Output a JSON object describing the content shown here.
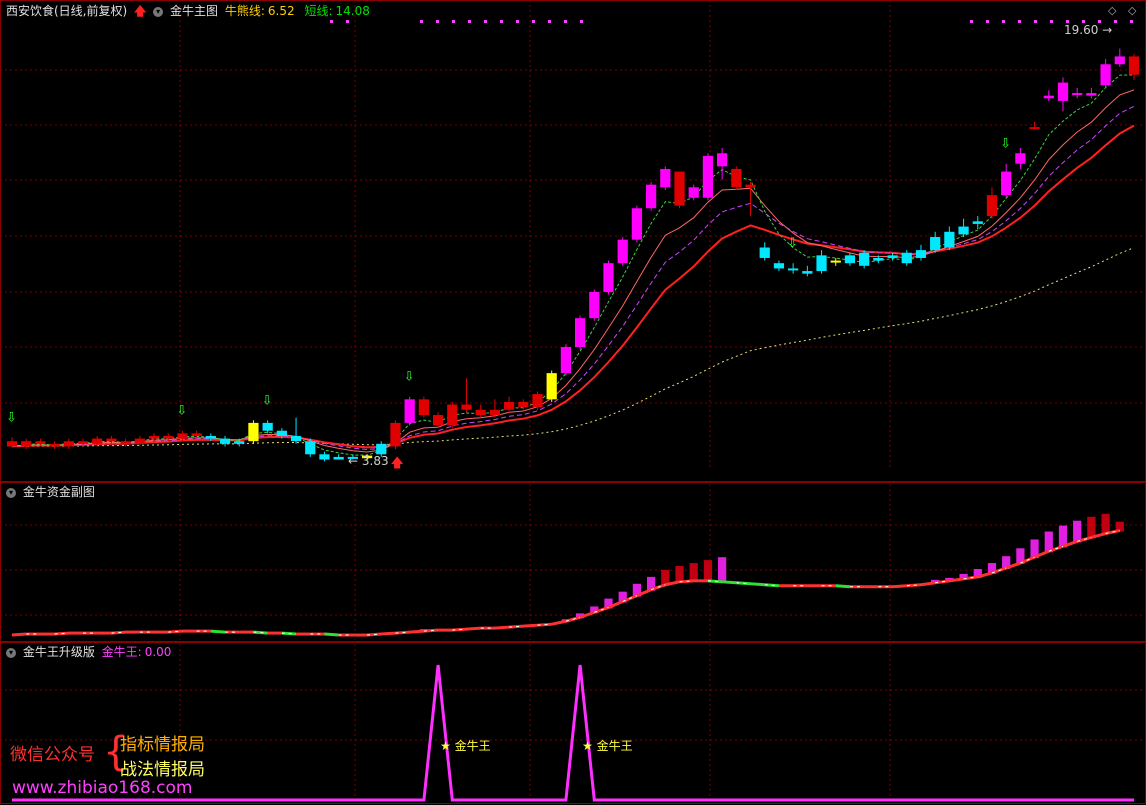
{
  "header": {
    "stock_title": "西安饮食(日线,前复权)",
    "main_indicator": "金牛主图",
    "bull_label": "牛熊线:",
    "bull_value": "6.52",
    "short_label": "短线:",
    "short_value": "14.08",
    "sub1_title": "金牛资金副图",
    "sub2_title": "金牛王升级版",
    "king_label": "金牛王:",
    "king_value": "0.00"
  },
  "colors": {
    "up": "#ff00ff",
    "up_big": "#e00000",
    "down": "#00e8ff",
    "signal": "#ffff00",
    "grid": "#7a0000",
    "bull_line": "#ff2020",
    "short_line": "#ff6666",
    "mid_line": "#cc44ff",
    "fast_line": "#40d040",
    "long_line": "#e8e070"
  },
  "chart_data": {
    "type": "candlestick",
    "price_high_label": "19.60",
    "price_low_label": "3.83",
    "candles": [
      [
        4.6,
        4.4,
        4.75,
        4.35,
        "r"
      ],
      [
        4.4,
        4.6,
        4.7,
        4.3,
        "r"
      ],
      [
        4.6,
        4.5,
        4.7,
        4.4,
        "r"
      ],
      [
        4.5,
        4.4,
        4.6,
        4.3,
        "r"
      ],
      [
        4.4,
        4.6,
        4.7,
        4.3,
        "r"
      ],
      [
        4.6,
        4.5,
        4.7,
        4.4,
        "r"
      ],
      [
        4.5,
        4.7,
        4.8,
        4.4,
        "r"
      ],
      [
        4.7,
        4.6,
        4.8,
        4.5,
        "r"
      ],
      [
        4.6,
        4.5,
        4.7,
        4.4,
        "r"
      ],
      [
        4.5,
        4.7,
        4.8,
        4.4,
        "r"
      ],
      [
        4.7,
        4.8,
        4.9,
        4.6,
        "r"
      ],
      [
        4.8,
        4.7,
        4.9,
        4.6,
        "r"
      ],
      [
        4.7,
        4.9,
        5.0,
        4.6,
        "r"
      ],
      [
        4.9,
        4.8,
        5.0,
        4.7,
        "r"
      ],
      [
        4.8,
        4.7,
        4.9,
        4.6,
        "c"
      ],
      [
        4.7,
        4.5,
        4.8,
        4.4,
        "c"
      ],
      [
        4.5,
        4.6,
        4.7,
        4.4,
        "c"
      ],
      [
        4.6,
        5.3,
        5.4,
        4.5,
        "y"
      ],
      [
        5.3,
        5.0,
        5.4,
        4.9,
        "c"
      ],
      [
        5.0,
        4.8,
        5.1,
        4.7,
        "c"
      ],
      [
        4.8,
        4.6,
        5.5,
        4.5,
        "c"
      ],
      [
        4.6,
        4.1,
        4.7,
        4.0,
        "c"
      ],
      [
        4.1,
        3.9,
        4.2,
        3.83,
        "c"
      ],
      [
        3.9,
        4.0,
        4.1,
        3.9,
        "c"
      ],
      [
        4.0,
        3.95,
        4.1,
        3.9,
        "c"
      ],
      [
        3.95,
        4.05,
        4.1,
        3.9,
        "y"
      ],
      [
        4.1,
        4.5,
        4.6,
        4.0,
        "c"
      ],
      [
        4.4,
        5.3,
        5.4,
        4.3,
        "r"
      ],
      [
        5.3,
        6.2,
        6.3,
        5.2,
        "m"
      ],
      [
        6.2,
        5.6,
        6.3,
        5.5,
        "r"
      ],
      [
        5.6,
        5.2,
        5.7,
        5.1,
        "r"
      ],
      [
        5.2,
        6.0,
        6.1,
        5.1,
        "r"
      ],
      [
        6.0,
        5.8,
        7.0,
        5.7,
        "r"
      ],
      [
        5.8,
        5.6,
        6.0,
        5.5,
        "r"
      ],
      [
        5.6,
        5.8,
        6.2,
        5.5,
        "r"
      ],
      [
        5.8,
        6.1,
        6.3,
        5.7,
        "r"
      ],
      [
        6.1,
        5.9,
        6.2,
        5.8,
        "r"
      ],
      [
        5.9,
        6.4,
        6.5,
        5.8,
        "r"
      ],
      [
        6.2,
        7.2,
        7.3,
        6.1,
        "y"
      ],
      [
        7.2,
        8.2,
        8.3,
        7.1,
        "m"
      ],
      [
        8.2,
        9.3,
        9.4,
        8.1,
        "m"
      ],
      [
        9.3,
        10.3,
        10.4,
        9.2,
        "m"
      ],
      [
        10.3,
        11.4,
        11.5,
        10.2,
        "m"
      ],
      [
        11.4,
        12.3,
        12.4,
        11.3,
        "m"
      ],
      [
        12.3,
        13.5,
        13.6,
        12.2,
        "m"
      ],
      [
        13.5,
        14.4,
        14.5,
        13.4,
        "m"
      ],
      [
        14.3,
        15.0,
        15.1,
        14.2,
        "m"
      ],
      [
        14.9,
        13.6,
        14.9,
        13.5,
        "r"
      ],
      [
        13.9,
        14.3,
        14.4,
        13.8,
        "m"
      ],
      [
        13.9,
        15.5,
        15.6,
        13.8,
        "m"
      ],
      [
        15.1,
        15.6,
        15.8,
        14.6,
        "m"
      ],
      [
        15.0,
        14.3,
        15.1,
        14.2,
        "r"
      ],
      [
        14.3,
        14.4,
        14.5,
        13.2,
        "r"
      ],
      [
        12.0,
        11.6,
        12.2,
        11.5,
        "c"
      ],
      [
        11.4,
        11.2,
        11.5,
        11.1,
        "c"
      ],
      [
        11.2,
        11.2,
        11.4,
        11.0,
        "c"
      ],
      [
        11.0,
        11.1,
        11.3,
        10.9,
        "c"
      ],
      [
        11.1,
        11.7,
        11.9,
        11.0,
        "c"
      ],
      [
        11.5,
        11.5,
        11.6,
        11.3,
        "y"
      ],
      [
        11.7,
        11.4,
        11.8,
        11.3,
        "c"
      ],
      [
        11.8,
        11.3,
        11.9,
        11.2,
        "c"
      ],
      [
        11.5,
        11.6,
        11.7,
        11.4,
        "c"
      ],
      [
        11.6,
        11.7,
        11.8,
        11.5,
        "c"
      ],
      [
        11.8,
        11.4,
        11.9,
        11.3,
        "c"
      ],
      [
        11.6,
        11.9,
        12.1,
        11.5,
        "c"
      ],
      [
        11.9,
        12.4,
        12.6,
        11.8,
        "c"
      ],
      [
        12.0,
        12.6,
        12.8,
        11.9,
        "c"
      ],
      [
        12.5,
        12.8,
        13.1,
        12.4,
        "c"
      ],
      [
        12.9,
        13.0,
        13.2,
        12.7,
        "c"
      ],
      [
        13.2,
        14.0,
        14.3,
        13.1,
        "r"
      ],
      [
        14.0,
        14.9,
        15.2,
        13.9,
        "m"
      ],
      [
        15.2,
        15.6,
        15.8,
        15.0,
        "m"
      ],
      [
        16.6,
        16.6,
        16.8,
        16.5,
        "r"
      ],
      [
        17.8,
        17.7,
        18.0,
        17.6,
        "m"
      ],
      [
        18.3,
        17.6,
        18.5,
        17.2,
        "m"
      ],
      [
        17.9,
        17.9,
        18.1,
        17.7,
        "m"
      ],
      [
        17.8,
        17.9,
        18.1,
        17.7,
        "m"
      ],
      [
        18.2,
        19.0,
        19.2,
        18.1,
        "m"
      ],
      [
        19.0,
        19.3,
        19.6,
        18.9,
        "m"
      ],
      [
        19.3,
        18.6,
        19.4,
        18.4,
        "r"
      ]
    ],
    "signal_markers": [
      {
        "type": "down-arrow",
        "index": 0
      },
      {
        "type": "down-arrow",
        "index": 12
      },
      {
        "type": "down-arrow",
        "index": 18
      },
      {
        "type": "down-arrow",
        "index": 28
      },
      {
        "type": "down-arrow",
        "index": 55
      },
      {
        "type": "down-arrow",
        "index": 70
      },
      {
        "type": "up-arrow",
        "index": 27
      }
    ],
    "fund_values": [
      0.3,
      0.4,
      0.4,
      0.4,
      0.5,
      0.5,
      0.5,
      0.5,
      0.6,
      0.6,
      0.6,
      0.6,
      0.7,
      0.7,
      0.7,
      0.6,
      0.6,
      0.6,
      0.5,
      0.5,
      0.4,
      0.4,
      0.4,
      0.3,
      0.3,
      0.3,
      0.4,
      0.5,
      0.6,
      0.7,
      0.8,
      0.8,
      0.9,
      1,
      1,
      1.1,
      1.2,
      1.3,
      1.4,
      1.7,
      2.1,
      2.6,
      3.1,
      3.7,
      4.3,
      4.9,
      5.4,
      5.7,
      5.8,
      5.8,
      5.7,
      5.6,
      5.5,
      5.4,
      5.3,
      5.3,
      5.3,
      5.3,
      5.3,
      5.2,
      5.2,
      5.2,
      5.2,
      5.3,
      5.4,
      5.6,
      5.8,
      6,
      6.2,
      6.6,
      7.1,
      7.6,
      8.2,
      8.8,
      9.3,
      9.8,
      10.2,
      10.6,
      10.9
    ],
    "fund_bars": [
      {
        "index": 29,
        "value": 0.9
      },
      {
        "index": 39,
        "value": 1.9
      },
      {
        "index": 40,
        "value": 2.5
      },
      {
        "index": 41,
        "value": 3.2
      },
      {
        "index": 42,
        "value": 4.0
      },
      {
        "index": 43,
        "value": 4.7
      },
      {
        "index": 44,
        "value": 5.5
      },
      {
        "index": 45,
        "value": 6.2
      },
      {
        "index": 46,
        "value": 6.9
      },
      {
        "index": 47,
        "value": 7.3
      },
      {
        "index": 48,
        "value": 7.6
      },
      {
        "index": 49,
        "value": 7.9
      },
      {
        "index": 50,
        "value": 8.2
      },
      {
        "index": 65,
        "value": 5.9
      },
      {
        "index": 66,
        "value": 6.1
      },
      {
        "index": 67,
        "value": 6.5
      },
      {
        "index": 68,
        "value": 7.0
      },
      {
        "index": 69,
        "value": 7.6
      },
      {
        "index": 70,
        "value": 8.3
      },
      {
        "index": 71,
        "value": 9.1
      },
      {
        "index": 72,
        "value": 10.0
      },
      {
        "index": 73,
        "value": 10.8
      },
      {
        "index": 74,
        "value": 11.4
      },
      {
        "index": 75,
        "value": 11.9
      },
      {
        "index": 76,
        "value": 12.3
      },
      {
        "index": 77,
        "value": 12.6
      },
      {
        "index": 78,
        "value": 11.8
      }
    ],
    "king_spikes": [
      {
        "index": 30,
        "value": 1,
        "label": "金牛王"
      },
      {
        "index": 40,
        "value": 1,
        "label": "金牛王"
      }
    ]
  },
  "watermark": {
    "account_label": "微信公众号",
    "line1": "指标情报局",
    "line2": "战法情报局",
    "url": "www.zhibiao168.com"
  }
}
